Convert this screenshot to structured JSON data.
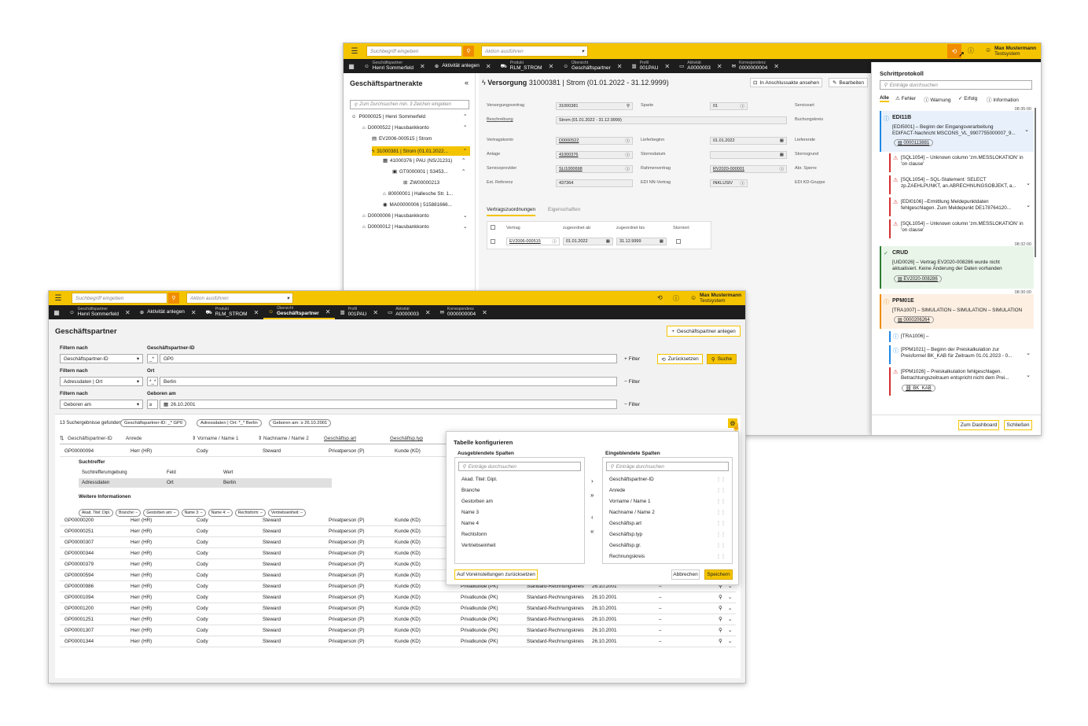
{
  "colors": {
    "accent": "#f5c400",
    "dark": "#1d1d1d",
    "error": "#d32f2f",
    "info": "#1e88e5",
    "success": "#2e7d32",
    "warning": "#ef8c00"
  },
  "back": {
    "search_placeholder": "Suchbegriff eingeben",
    "action_placeholder": "Aktion ausführen",
    "user_name": "Max Mustermann",
    "user_system": "Testsystem",
    "tabs": [
      {
        "label": "Geschäftspartner",
        "value": "Henri Sommerfeld"
      },
      {
        "label": "",
        "value": "Aktivität anlegen"
      },
      {
        "label": "Produkt",
        "value": "RLM_STROM"
      },
      {
        "label": "Übersicht",
        "value": "Geschäftspartner"
      },
      {
        "label": "Profil",
        "value": "001PAU"
      },
      {
        "label": "Aktivität",
        "value": "A0000003"
      },
      {
        "label": "Korrespondenz",
        "value": "0000000004"
      }
    ],
    "sidebar": {
      "title": "Geschäftspartnerakte",
      "search_placeholder": "Zum Durchsuchen min. 3 Zeichen eingeben",
      "tree": [
        "P0000025 | Henri Sommerfeld",
        "D0000522 | Hausbankkonto",
        "EV2006-000515 | Strom",
        "31000381 | Strom (01.01.2022...",
        "41000376 | PAU (NS/J1231)",
        "GT0000001 | S3453...",
        "ZW00000213",
        "80000001 | Hallesche Str. 1...",
        "MA00000006 | 515881666...",
        "D0000006 | Hausbankkonto",
        "D0000012 | Hausbankkonto"
      ]
    },
    "main": {
      "title_prefix": "Versorgung",
      "title": "31000381 | Strom (01.01.2022 - 31.12.9999)",
      "btn_open": "In Anschlussakte ansehen",
      "btn_edit": "Bearbeiten",
      "f_versorgungsvertrag_l": "Versorgungsvertrag",
      "f_versorgungsvertrag_v": "31000381",
      "f_sparte_l": "Sparte",
      "f_sparte_v": "01",
      "f_serviceart_l": "Serviceart",
      "f_beschreibung_l": "Beschreibung",
      "f_beschreibung_v": "Strom (01.01.2022 - 31.12.9999)",
      "f_buchungskreis_l": "Buchungskreis",
      "f_vertragskonto_l": "Vertragskonto",
      "f_vertragskonto_v": "D0000522",
      "f_lieferbeginn_l": "Lieferbeginn",
      "f_lieferbeginn_v": "01.01.2022",
      "f_lieferende_l": "Lieferende",
      "f_anlage_l": "Anlage",
      "f_anlage_v": "41000376",
      "f_stornodatum_l": "Stornodatum",
      "f_storngrund_l": "Stornogrund",
      "f_serviceprovider_l": "Serviceprovider",
      "f_serviceprovider_v": "SLI1000698",
      "f_rahmenvertrag_l": "Rahmenvertrag",
      "f_rahmenvertrag_v": "RV2020-000001",
      "f_abrsperre_l": "Abr. Sperre",
      "f_extref_l": "Ext. Referenz",
      "f_extref_v": "437364",
      "f_ediinn_l": "EDI NN-Vertrag",
      "f_ediinn_v": "INKLUSIV",
      "f_edikd_l": "EDI KD-Gruppe",
      "tab1": "Vertragszuordnungen",
      "tab2": "Eigenschaften",
      "tbl_h1": "Vertrag",
      "tbl_h2": "zugeordnet ab",
      "tbl_h3": "zugeordnet bis",
      "tbl_h4": "Storniert",
      "tbl_v1": "EV2006-000515",
      "tbl_v2": "01.01.2022",
      "tbl_v3": "31.12.9999"
    },
    "log": {
      "title": "Schrittprotokoll",
      "search_placeholder": "Einträge durchsuchen",
      "filters": [
        "Alle",
        "Fehler",
        "Warnung",
        "Erfolg",
        "Information"
      ],
      "t1": "08:35:00",
      "g1_title": "EDI11B",
      "g1_l1": "[EDI5001] – Beginn der Eingangsverarbeitung",
      "g1_l2": "EDIFACT-Nachricht MSCONS_VL_9907755000007_9...",
      "g1_badge": "0000113881",
      "e1_l1": "[SQL1054] – Unknown column 'zm.MESSLOKATION' in",
      "e1_l2": "'on clause'",
      "e2_l1": "[SQL1054] – SQL-Statement: SELECT",
      "e2_l2": "zp.ZAEHLPUNKT, an.ABRECHNUNGSOBJEKT, a...",
      "e3_l1": "[EDI0106] –Ermittlung Meldepunktdaten",
      "e3_l2": "fehlgeschlagen. Zum Meldepunkt DE178764120...",
      "e4_l1": "[SQL1054] – Unknown column 'zm.MESSLOKATION' in",
      "e4_l2": "'on clause'",
      "t2": "08:32:00",
      "g2_title": "CRUD",
      "g2_l1": "[UID0026] – Vertrag EV2020-008286 wurde nicht",
      "g2_l2": "aktualisiert. Keine Änderung der Daten vorhanden",
      "g2_badge": "EV2020-008286",
      "t3": "08:30:00",
      "g3_title": "PPM01E",
      "g3_l1": "[TRA1007] – SIMULATION – SIMULATION – SIMULATION",
      "g3_badge": "0000206264",
      "i1": "[TRA1006] –",
      "i2_l1": "[PPM1021] – Beginn der Preiskalkulation zur",
      "i2_l2": "Preisformel BK_KAB für Zeitraum 01.01.2023 - 0...",
      "i3_l1": "[PPM1026] – Preiskalkulation fehlgeschlagen.",
      "i3_l2": "Betrachtungszeitraum entspricht nicht dem Prei...",
      "i3_badge": "BK_KAB",
      "btn_dashboard": "Zum Dashboard",
      "btn_close": "Schließen"
    }
  },
  "front": {
    "search_placeholder": "Suchbegriff eingeben",
    "action_placeholder": "Aktion ausführen",
    "user_name": "Max Mustermann",
    "user_system": "Testsystem",
    "tabs": [
      {
        "label": "Geschäftspartner",
        "value": "Henri Sommerfeld"
      },
      {
        "label": "",
        "value": "Aktivität anlegen"
      },
      {
        "label": "Produkt",
        "value": "RLM_STROM"
      },
      {
        "label": "Übersicht",
        "value": "Geschäftspartner"
      },
      {
        "label": "Profil",
        "value": "001PAU"
      },
      {
        "label": "Aktivität",
        "value": "A0000003"
      },
      {
        "label": "Korrespondenz",
        "value": "0000000004"
      }
    ],
    "page_title": "Geschäftspartner",
    "btn_create": "Geschäftspartner anlegen",
    "filter_label": "Filtern nach",
    "f1_select": "Geschäftspartner-ID",
    "f1_field_label": "Geschäftspartner-ID",
    "f1_op": "_*",
    "f1_value": "GP0",
    "f2_select": "Adressdaten | Ort",
    "f2_field_label": "Ort",
    "f2_op": "*_*",
    "f2_value": "Berlin",
    "f3_select": "Geboren am",
    "f3_field_label": "Geboren am",
    "f3_op": "≥",
    "f3_value": "26.10.2001",
    "btn_filter": "Filter",
    "btn_reset": "Zurücksetzen",
    "btn_search": "Suche",
    "results_text": "13 Suchergebnisse gefunden",
    "chips": [
      "Geschäftspartner-ID: _* GP0",
      "Adressdaten | Ort: *_* Berlin",
      "Geboren am: ≥ 26.10.2001"
    ],
    "columns": [
      "Geschäftspartner-ID",
      "Anrede",
      "Vorname / Name 1",
      "Nachname / Name 2",
      "Geschäftsp.art",
      "Geschäftsp.typ"
    ],
    "detail": {
      "title": "Suchtreffer",
      "h1": "Suchtrefferumgebung",
      "h2": "Feld",
      "h3": "Wert",
      "v1": "Adressdaten",
      "v2": "Ort",
      "v3": "Berlin",
      "more": "Weitere Informationen",
      "chips": [
        "Akad. Titel: Dipl.",
        "Branche: –",
        "Gestorben am: –",
        "Name 3: –",
        "Name 4: –",
        "Rechtsform: –",
        "Vertriebseinheit: –"
      ]
    },
    "rows": [
      [
        "GP00000094",
        "Herr (HR)",
        "Cody",
        "Steward",
        "Privatperson (P)",
        "Kunde (KD)",
        "",
        "",
        "",
        ""
      ],
      [
        "GP00000200",
        "Herr (HR)",
        "Cody",
        "Steward",
        "Privatperson (P)",
        "Kunde (KD)",
        "",
        "",
        "",
        ""
      ],
      [
        "GP00000251",
        "Herr (HR)",
        "Cody",
        "Steward",
        "Privatperson (P)",
        "Kunde (KD)",
        "",
        "",
        "",
        ""
      ],
      [
        "GP00000307",
        "Herr (HR)",
        "Cody",
        "Steward",
        "Privatperson (P)",
        "Kunde (KD)",
        "",
        "",
        "",
        ""
      ],
      [
        "GP00000344",
        "Herr (HR)",
        "Cody",
        "Steward",
        "Privatperson (P)",
        "Kunde (KD)",
        "",
        "",
        "",
        ""
      ],
      [
        "GP00000379",
        "Herr (HR)",
        "Cody",
        "Steward",
        "Privatperson (P)",
        "Kunde (KD)",
        "",
        "",
        "",
        ""
      ],
      [
        "GP00000594",
        "Herr (HR)",
        "Cody",
        "Steward",
        "Privatperson (P)",
        "Kunde (KD)",
        "",
        "",
        "",
        ""
      ],
      [
        "GP00000986",
        "Herr (HR)",
        "Cody",
        "Steward",
        "Privatperson (P)",
        "Kunde (KD)",
        "Privatkunde (PK)",
        "Standard-Rechnungskreis",
        "26.10.2001",
        "–"
      ],
      [
        "GP00001094",
        "Herr (HR)",
        "Cody",
        "Steward",
        "Privatperson (P)",
        "Kunde (KD)",
        "Privatkunde (PK)",
        "Standard-Rechnungskreis",
        "26.10.2001",
        "–"
      ],
      [
        "GP00001200",
        "Herr (HR)",
        "Cody",
        "Steward",
        "Privatperson (P)",
        "Kunde (KD)",
        "Privatkunde (PK)",
        "Standard-Rechnungskreis",
        "26.10.2001",
        "–"
      ],
      [
        "GP00001251",
        "Herr (HR)",
        "Cody",
        "Steward",
        "Privatperson (P)",
        "Kunde (KD)",
        "Privatkunde (PK)",
        "Standard-Rechnungskreis",
        "26.10.2001",
        "–"
      ],
      [
        "GP00001307",
        "Herr (HR)",
        "Cody",
        "Steward",
        "Privatperson (P)",
        "Kunde (KD)",
        "Privatkunde (PK)",
        "Standard-Rechnungskreis",
        "26.10.2001",
        "–"
      ],
      [
        "GP00001344",
        "Herr (HR)",
        "Cody",
        "Steward",
        "Privatperson (P)",
        "Kunde (KD)",
        "Privatkunde (PK)",
        "Standard-Rechnungskreis",
        "26.10.2001",
        "–"
      ]
    ],
    "config": {
      "title": "Tabelle konfigurieren",
      "hidden_title": "Ausgeblendete Spalten",
      "shown_title": "Eingeblendete Spalten",
      "search_placeholder": "Einträge durchsuchen",
      "hidden": [
        "Akad. Titel: Dipl.",
        "Branche",
        "Gestorben am",
        "Name 3",
        "Name 4",
        "Rechtsform",
        "Vertriebseinheit"
      ],
      "shown": [
        "Geschäftspartner-ID",
        "Anrede",
        "Vorname / Name 1",
        "Nachname / Name 2",
        "Geschäftsp.art",
        "Geschäftsp.typ",
        "Geschäftsp.gr.",
        "Rechnungskreis"
      ],
      "btn_reset": "Auf Voreinstellungen zurücksetzen",
      "btn_cancel": "Abbrechen",
      "btn_save": "Speichern"
    }
  }
}
